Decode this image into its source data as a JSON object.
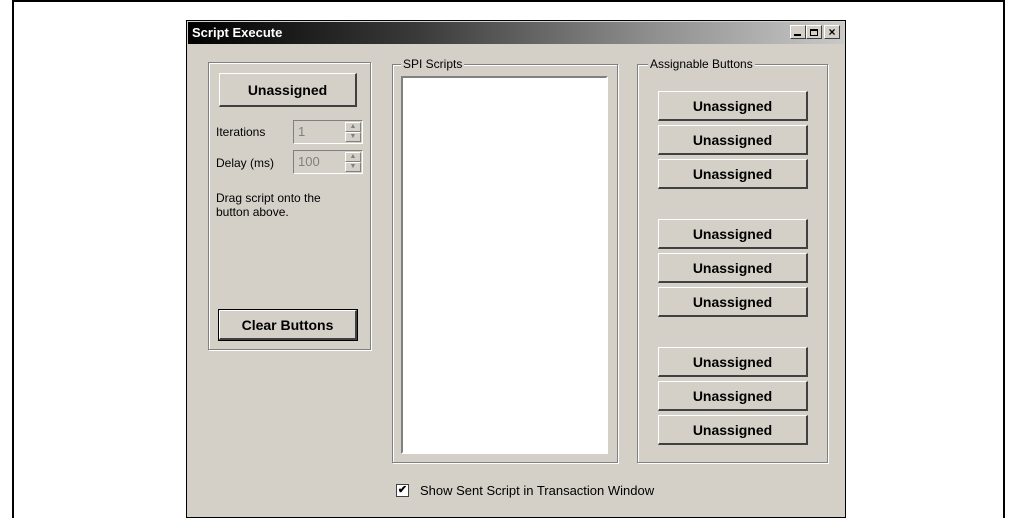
{
  "window": {
    "title": "Script Execute",
    "controls": [
      "minimize-icon",
      "maximize-icon",
      "close-icon"
    ]
  },
  "left_panel": {
    "assigned_button": "Unassigned",
    "iterations_label": "Iterations",
    "iterations_value": "1",
    "delay_label": "Delay (ms)",
    "delay_value": "100",
    "hint_line1": "Drag script onto the",
    "hint_line2": "button above.",
    "clear_button": "Clear Buttons"
  },
  "spi_scripts": {
    "label": "SPI Scripts",
    "items": []
  },
  "assignable": {
    "label": "Assignable Buttons",
    "buttons": [
      "Unassigned",
      "Unassigned",
      "Unassigned",
      "Unassigned",
      "Unassigned",
      "Unassigned",
      "Unassigned",
      "Unassigned",
      "Unassigned"
    ]
  },
  "footer": {
    "show_sent_checked": true,
    "show_sent_label": "Show Sent Script in Transaction Window"
  }
}
